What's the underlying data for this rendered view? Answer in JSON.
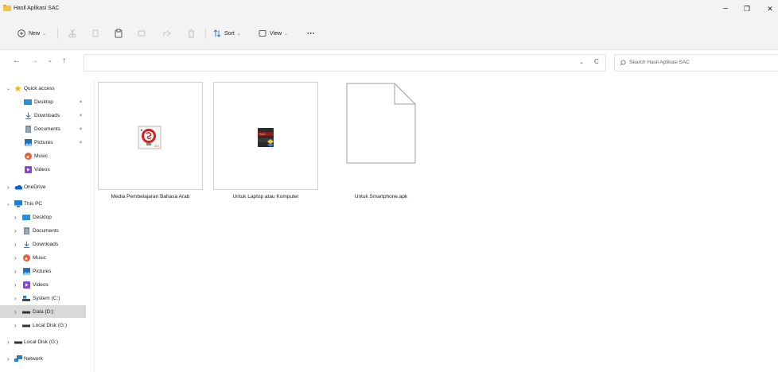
{
  "window": {
    "title": "Hasil Aplikasi SAC",
    "controls": {
      "minimize": "–",
      "maximize": "❐",
      "close": "✕"
    }
  },
  "toolbar": {
    "new_label": "New",
    "sort_label": "Sort",
    "view_label": "View",
    "more_label": "···",
    "chevron": "⌄"
  },
  "navigation": {
    "back": "←",
    "forward": "→",
    "recent": "⌄",
    "up": "↑",
    "address_dropdown": "⌄",
    "refresh": "C",
    "search_placeholder": "Search Hasil Aplikasi SAC"
  },
  "sidebar": {
    "quick_access": {
      "label": "Quick access",
      "items": [
        {
          "label": "Desktop",
          "icon": "desktop-icon",
          "pinned": true
        },
        {
          "label": "Downloads",
          "icon": "downloads-icon",
          "pinned": true
        },
        {
          "label": "Documents",
          "icon": "documents-icon",
          "pinned": true
        },
        {
          "label": "Pictures",
          "icon": "pictures-icon",
          "pinned": true
        },
        {
          "label": "Music",
          "icon": "music-icon",
          "pinned": false
        },
        {
          "label": "Videos",
          "icon": "videos-icon",
          "pinned": false
        }
      ]
    },
    "onedrive": {
      "label": "OneDrive"
    },
    "this_pc": {
      "label": "This PC",
      "items": [
        {
          "label": "Desktop",
          "icon": "desktop-icon"
        },
        {
          "label": "Documents",
          "icon": "documents-icon"
        },
        {
          "label": "Downloads",
          "icon": "downloads-icon"
        },
        {
          "label": "Music",
          "icon": "music-icon"
        },
        {
          "label": "Pictures",
          "icon": "pictures-icon"
        },
        {
          "label": "Videos",
          "icon": "videos-icon"
        },
        {
          "label": "System (C:)",
          "icon": "system-drive-icon"
        },
        {
          "label": "Data (D:)",
          "icon": "drive-icon",
          "selected": true
        },
        {
          "label": "Local Disk (G:)",
          "icon": "drive-icon"
        }
      ]
    },
    "local_disk": {
      "label": "Local Disk (G:)"
    },
    "network": {
      "label": "Network"
    },
    "pin_glyph": "📌",
    "expanded_glyph": "⌄",
    "collapsed_glyph": "›"
  },
  "files": [
    {
      "name": "Media Pembelajaran Bahasa Arab",
      "type": "app-shortcut",
      "icon": "sac-app-icon"
    },
    {
      "name": "Untuk Laptop atau Komputer",
      "type": "folder-archive",
      "icon": "winrar-archive-icon"
    },
    {
      "name": "Untuk Smartphone.apk",
      "type": "apk-file",
      "icon": "blank-file-icon"
    }
  ],
  "colors": {
    "chrome": "#f3f3f3",
    "selected": "#d9d9d9",
    "accent": "#0067c0",
    "folder": "#f6c343",
    "star": "#f4b400"
  }
}
